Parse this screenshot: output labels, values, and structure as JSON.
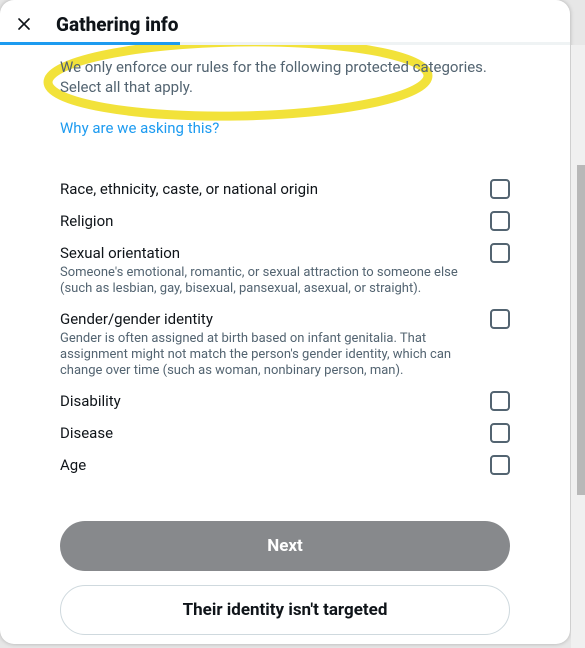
{
  "header": {
    "title": "Gathering info"
  },
  "intro": "We only enforce our rules for the following protected categories. Select all that apply.",
  "why_link": "Why are we asking this?",
  "categories": [
    {
      "label": "Race, ethnicity, caste, or national origin",
      "desc": ""
    },
    {
      "label": "Religion",
      "desc": ""
    },
    {
      "label": "Sexual orientation",
      "desc": "Someone's emotional, romantic, or sexual attraction to someone else (such as lesbian, gay, bisexual, pansexual, asexual, or straight)."
    },
    {
      "label": "Gender/gender identity",
      "desc": "Gender is often assigned at birth based on infant genitalia. That assignment might not match the person's gender identity, which can change over time (such as woman, nonbinary person, man)."
    },
    {
      "label": "Disability",
      "desc": ""
    },
    {
      "label": "Disease",
      "desc": ""
    },
    {
      "label": "Age",
      "desc": ""
    }
  ],
  "buttons": {
    "primary": "Next",
    "secondary": "Their identity isn't targeted"
  },
  "colors": {
    "accent": "#1D9BF0",
    "highlight": "#F2E23A"
  }
}
